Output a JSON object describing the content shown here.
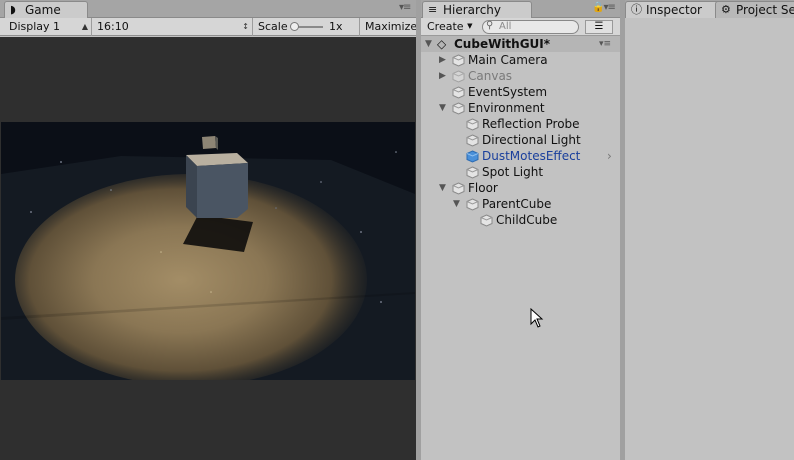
{
  "game": {
    "tab_title": "Game",
    "display_label": "Display 1",
    "aspect_label": "16:10",
    "scale_label": "Scale",
    "scale_value": "1x",
    "maximize_label": "Maximize"
  },
  "hierarchy": {
    "tab_title": "Hierarchy",
    "create_label": "Create",
    "search_placeholder": "All",
    "scene_name": "CubeWithGUI*",
    "items": [
      {
        "label": "Main Camera"
      },
      {
        "label": "Canvas"
      },
      {
        "label": "EventSystem"
      },
      {
        "label": "Environment"
      },
      {
        "label": "Reflection Probe"
      },
      {
        "label": "Directional Light"
      },
      {
        "label": "DustMotesEffect"
      },
      {
        "label": "Spot Light"
      },
      {
        "label": "Floor"
      },
      {
        "label": "ParentCube"
      },
      {
        "label": "ChildCube"
      }
    ]
  },
  "inspector": {
    "tab_title": "Inspector",
    "project_tab_title": "Project Se"
  },
  "colors": {
    "selected_text": "#1a3f9c",
    "inactive_text": "#7a7a7a",
    "prefab_icon": "#4a90d9"
  }
}
